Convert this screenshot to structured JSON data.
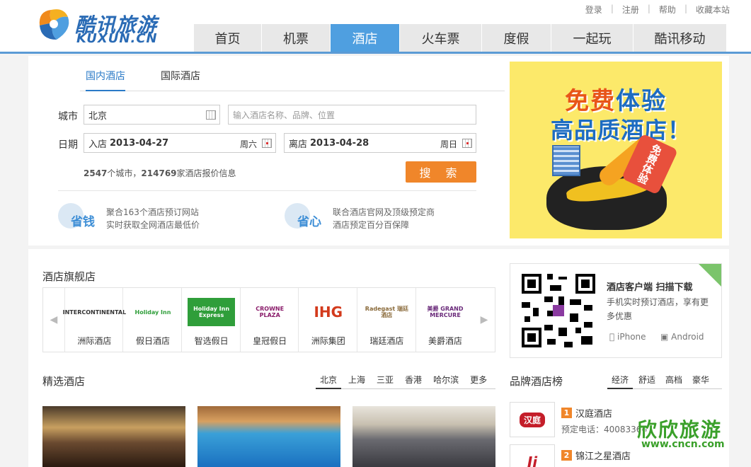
{
  "top_links": [
    "登录",
    "注册",
    "帮助",
    "收藏本站"
  ],
  "logo": {
    "cn": "酷讯旅游",
    "en": "KUXUN.CN"
  },
  "nav": [
    {
      "label": "首页",
      "width": 96
    },
    {
      "label": "机票",
      "width": 97
    },
    {
      "label": "酒店",
      "width": 98,
      "active": true
    },
    {
      "label": "火车票",
      "width": 116
    },
    {
      "label": "度假",
      "width": 98
    },
    {
      "label": "一起玩",
      "width": 116
    },
    {
      "label": "酷讯移动",
      "width": 132
    }
  ],
  "search": {
    "tabs": [
      "国内酒店",
      "国际酒店"
    ],
    "city_label": "城市",
    "city_value": "北京",
    "keyword_placeholder": "输入酒店名称、品牌、位置",
    "date_label": "日期",
    "checkin_prefix": "入店",
    "checkin_date": "2013-04-27",
    "checkin_dow": "周六",
    "checkout_prefix": "离店",
    "checkout_date": "2013-04-28",
    "checkout_dow": "周日",
    "stats_cities": "2547",
    "stats_mid": "个城市，",
    "stats_hotels": "214769",
    "stats_tail": "家酒店报价信息",
    "button": "搜 索"
  },
  "features": [
    {
      "badge": "省钱",
      "line1": "聚合163个酒店预订网站",
      "line2": "实时获取全网酒店最低价"
    },
    {
      "badge": "省心",
      "line1": "联合酒店官网及顶级预定商",
      "line2": "酒店预定百分百保障"
    }
  ],
  "ad": {
    "line1a": "免费",
    "line1b": "体验",
    "line2": "高品质酒店！",
    "tag": "免费体验"
  },
  "flagship": {
    "title": "酒店旗舰店",
    "brands": [
      {
        "name": "洲际酒店",
        "logo": "INTERCONTINENTAL",
        "color": "#333333"
      },
      {
        "name": "假日酒店",
        "logo": "Holiday Inn",
        "color": "#2f9e3a"
      },
      {
        "name": "智选假日",
        "logo": "Holiday Inn Express",
        "color": "#2f9e3a"
      },
      {
        "name": "皇冠假日",
        "logo": "CROWNE PLAZA",
        "color": "#8a1c6a"
      },
      {
        "name": "洲际集团",
        "logo": "IHG",
        "color": "#d33a1c"
      },
      {
        "name": "瑞廷酒店",
        "logo": "Radegast 瑞廷酒店",
        "color": "#8a6a3a"
      },
      {
        "name": "美爵酒店",
        "logo": "美爵 GRAND MERCURE",
        "color": "#6a2a7a"
      }
    ]
  },
  "app": {
    "title": "酒店客户端 扫描下载",
    "desc": "手机实时预订酒店，享有更多优惠",
    "iphone": "iPhone",
    "android": "Android"
  },
  "selected": {
    "title": "精选酒店",
    "cities": [
      "北京",
      "上海",
      "三亚",
      "香港",
      "哈尔滨",
      "更多"
    ]
  },
  "ranking": {
    "title": "品牌酒店榜",
    "tabs": [
      "经济",
      "舒适",
      "高档",
      "豪华"
    ],
    "items": [
      {
        "rank": "1",
        "name": "汉庭酒店",
        "phone": "预定电话：40083366",
        "logo": "汉庭"
      },
      {
        "rank": "2",
        "name": "锦江之星酒店",
        "phone": "",
        "logo": "Ji"
      }
    ]
  },
  "watermark": {
    "text": "欣欣旅游",
    "url": "www.cncn.com"
  },
  "colors": {
    "accent": "#4f9fe0",
    "orange": "#f0862a"
  }
}
